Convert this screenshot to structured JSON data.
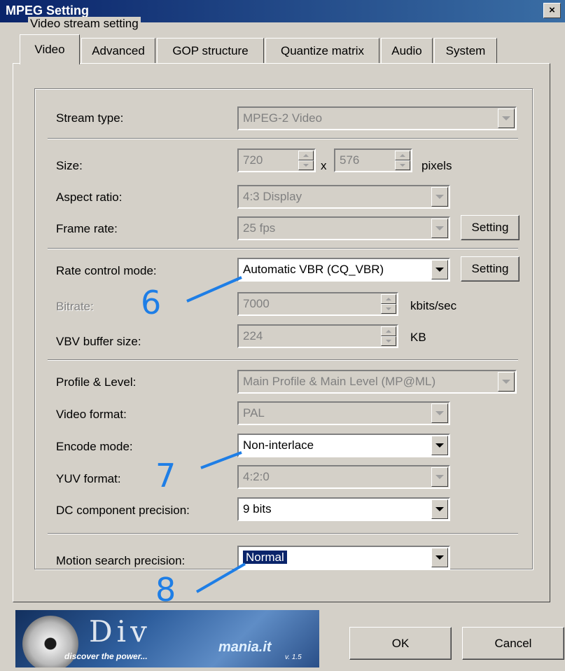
{
  "window": {
    "title": "MPEG Setting",
    "close_glyph": "×"
  },
  "tabs": [
    "Video",
    "Advanced",
    "GOP structure",
    "Quantize matrix",
    "Audio",
    "System"
  ],
  "group_title": "Video stream setting",
  "fields": {
    "stream_type": {
      "label": "Stream type:",
      "value": "MPEG-2 Video"
    },
    "size": {
      "label": "Size:",
      "width": "720",
      "sep": "x",
      "height": "576",
      "unit": "pixels"
    },
    "aspect_ratio": {
      "label": "Aspect ratio:",
      "value": "4:3 Display"
    },
    "frame_rate": {
      "label": "Frame rate:",
      "value": "25 fps",
      "button": "Setting"
    },
    "rate_control": {
      "label": "Rate control mode:",
      "value": "Automatic VBR (CQ_VBR)",
      "button": "Setting"
    },
    "bitrate": {
      "label": "Bitrate:",
      "value": "7000",
      "unit": "kbits/sec"
    },
    "vbv": {
      "label": "VBV buffer size:",
      "value": "224",
      "unit": "KB"
    },
    "profile_level": {
      "label": "Profile & Level:",
      "value": "Main Profile & Main Level (MP@ML)"
    },
    "video_format": {
      "label": "Video format:",
      "value": "PAL"
    },
    "encode_mode": {
      "label": "Encode mode:",
      "value": "Non-interlace"
    },
    "yuv_format": {
      "label": "YUV format:",
      "value": "4:2:0"
    },
    "dc_precision": {
      "label": "DC component precision:",
      "value": "9 bits"
    },
    "motion_search": {
      "label": "Motion search precision:",
      "value": "Normal"
    }
  },
  "annotations": [
    "6",
    "7",
    "8"
  ],
  "buttons": {
    "ok": "OK",
    "cancel": "Cancel"
  },
  "logo": {
    "main": "Div",
    "tagline": "discover the power...",
    "site": "mania.it",
    "version": "v. 1.5"
  },
  "colors": {
    "accent": "#1e7ee6",
    "title_bar": "#0a246a",
    "face": "#d4d0c8"
  }
}
